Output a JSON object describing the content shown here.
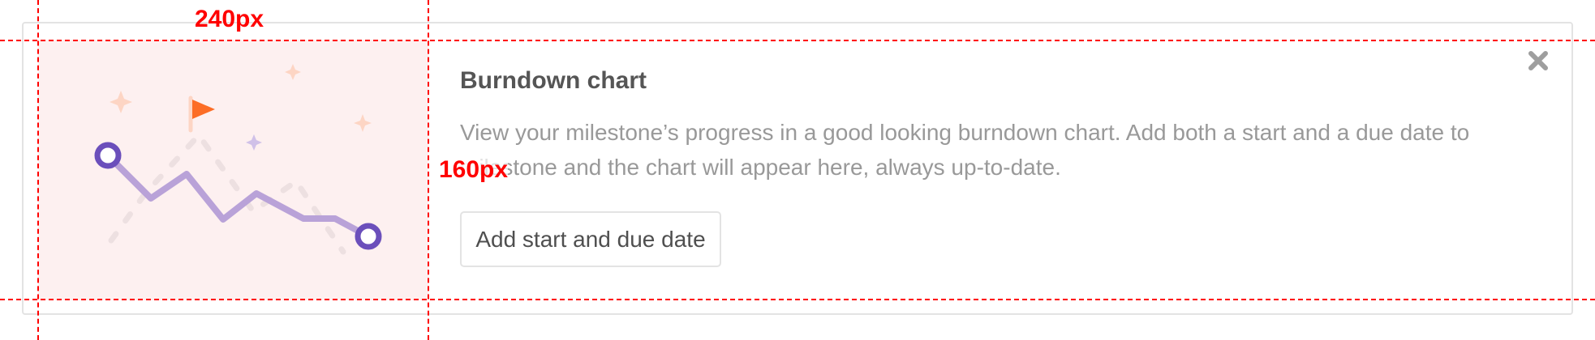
{
  "empty_state": {
    "title": "Burndown chart",
    "description_start": "View your milestone’s progress in a good looking burndown chart. Add both a start and a due date to ",
    "description_faded": "m",
    "description_end": "ilestone and the chart will appear here, always up-to-date.",
    "button_label": "Add start and due date",
    "close_icon": "close-icon",
    "illustration_icon": "burndown-illustration"
  },
  "annotations": {
    "width_label": "240px",
    "height_label": "160px"
  },
  "colors": {
    "illustration_background": "#fdf0f0",
    "line": "#b9a2d8",
    "endpoint": "#6b4fbb",
    "flag": "#fc6d26",
    "guide": "#ff0000"
  }
}
